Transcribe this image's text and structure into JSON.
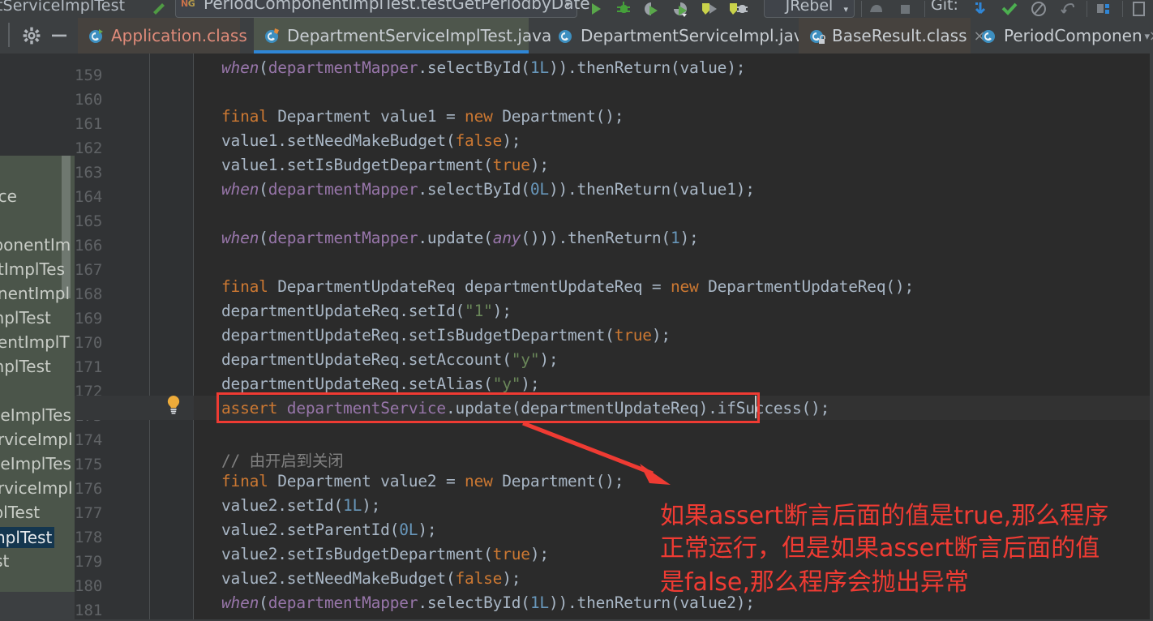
{
  "toolbar": {
    "breadcrumb_text": "tServiceImplTest",
    "run_config": {
      "icon": "testng-icon",
      "icon_text": "N",
      "icon_text2": "G",
      "label": "PeriodComponentImplTest.testGetPeriodbyDate",
      "arrow": "▾"
    },
    "icons": [
      {
        "name": "run-icon",
        "glyph": "▶",
        "color": "#5a9b4f"
      },
      {
        "name": "debug-icon",
        "glyph": "✱",
        "color": "#4a9c3f"
      },
      {
        "name": "run-with-coverage-icon",
        "glyph": "▶",
        "color": "#6aa050"
      },
      {
        "name": "profile-icon",
        "glyph": "▶",
        "color": "#6aa050"
      },
      {
        "name": "run-test-icon",
        "glyph": "▶",
        "color": "#9aa845"
      },
      {
        "name": "debug-test-icon",
        "glyph": "▶",
        "color": "#9aa845"
      }
    ],
    "jrebel_label": "JRebel",
    "right_icons": [
      {
        "name": "attach-process-icon",
        "glyph": "●"
      },
      {
        "name": "stop-icon",
        "glyph": "■"
      },
      {
        "name": "git-label",
        "glyph": "Git:"
      },
      {
        "name": "update-project-icon",
        "glyph": "↰"
      },
      {
        "name": "commit-icon",
        "glyph": "✔"
      },
      {
        "name": "history-icon",
        "glyph": "⧖"
      },
      {
        "name": "rollback-icon",
        "glyph": "↶"
      },
      {
        "name": "layout-icon",
        "glyph": "▦"
      },
      {
        "name": "search-everywhere-icon",
        "glyph": "⌕"
      }
    ]
  },
  "tabbar": {
    "gear_icon": "settings-gear-icon",
    "minimize_icon": "hide-icon",
    "tabs": [
      {
        "label": "Application.class",
        "icon": "java-class-icon",
        "active": false,
        "color": "#e08b7a",
        "close": "×"
      },
      {
        "label": "DepartmentServiceImplTest.java",
        "icon": "java-file-icon",
        "active": true,
        "color": "#c8cdd2",
        "close": "×"
      },
      {
        "label": "DepartmentServiceImpl.java",
        "icon": "java-file-icon",
        "active": false,
        "color": "#c8cdd2",
        "close": "×"
      },
      {
        "label": "BaseResult.class",
        "icon": "java-class-locked-icon",
        "active": false,
        "color": "#c8cdd2",
        "close": "×"
      },
      {
        "label": "PeriodComponen",
        "icon": "java-class-icon",
        "active": false,
        "color": "#c8cdd2",
        "close": "×"
      }
    ],
    "overflow": "▾"
  },
  "project_panel": {
    "rows": [
      "rvice",
      "mponentIm",
      "entImplTes",
      "ponentImpl",
      "tImplTest",
      "onentImplT",
      "tImplTest",
      "viceImplTes",
      "ServiceImpl",
      "viceImplTes",
      "ServiceImpl",
      "mplTest",
      "eImplTest",
      "Test"
    ],
    "selected_index": 12
  },
  "editor": {
    "first_line_number": 159,
    "line_height": 30,
    "caret_line": 173,
    "bulb_icon": "intention-bulb-icon",
    "lines": [
      {
        "n": 159,
        "tokens": [
          {
            "t": "when",
            "c": "stm"
          },
          {
            "t": "(",
            "c": "id"
          },
          {
            "t": "departmentMapper",
            "c": "fld"
          },
          {
            "t": ".selectById(",
            "c": "id"
          },
          {
            "t": "1L",
            "c": "num"
          },
          {
            "t": ")).thenReturn(value);",
            "c": "id"
          }
        ]
      },
      {
        "n": 160,
        "tokens": []
      },
      {
        "n": 161,
        "tokens": [
          {
            "t": "final",
            "c": "kw"
          },
          {
            "t": " Department value1 = ",
            "c": "id"
          },
          {
            "t": "new",
            "c": "kw"
          },
          {
            "t": " Department();",
            "c": "id"
          }
        ]
      },
      {
        "n": 162,
        "tokens": [
          {
            "t": "value1.setNeedMakeBudget(",
            "c": "id"
          },
          {
            "t": "false",
            "c": "kw"
          },
          {
            "t": ");",
            "c": "id"
          }
        ]
      },
      {
        "n": 163,
        "tokens": [
          {
            "t": "value1.setIsBudgetDepartment(",
            "c": "id"
          },
          {
            "t": "true",
            "c": "kw"
          },
          {
            "t": ");",
            "c": "id"
          }
        ]
      },
      {
        "n": 164,
        "tokens": [
          {
            "t": "when",
            "c": "stm"
          },
          {
            "t": "(",
            "c": "id"
          },
          {
            "t": "departmentMapper",
            "c": "fld"
          },
          {
            "t": ".selectById(",
            "c": "id"
          },
          {
            "t": "0L",
            "c": "num"
          },
          {
            "t": ")).thenReturn(value1);",
            "c": "id"
          }
        ]
      },
      {
        "n": 165,
        "tokens": []
      },
      {
        "n": 166,
        "tokens": [
          {
            "t": "when",
            "c": "stm"
          },
          {
            "t": "(",
            "c": "id"
          },
          {
            "t": "departmentMapper",
            "c": "fld"
          },
          {
            "t": ".update(",
            "c": "id"
          },
          {
            "t": "any",
            "c": "stm"
          },
          {
            "t": "())).thenReturn(",
            "c": "id"
          },
          {
            "t": "1",
            "c": "num"
          },
          {
            "t": ");",
            "c": "id"
          }
        ]
      },
      {
        "n": 167,
        "tokens": []
      },
      {
        "n": 168,
        "tokens": [
          {
            "t": "final",
            "c": "kw"
          },
          {
            "t": " DepartmentUpdateReq departmentUpdateReq = ",
            "c": "id"
          },
          {
            "t": "new",
            "c": "kw"
          },
          {
            "t": " DepartmentUpdateReq();",
            "c": "id"
          }
        ]
      },
      {
        "n": 169,
        "tokens": [
          {
            "t": "departmentUpdateReq.setId(",
            "c": "id"
          },
          {
            "t": "\"1\"",
            "c": "st"
          },
          {
            "t": ");",
            "c": "id"
          }
        ]
      },
      {
        "n": 170,
        "tokens": [
          {
            "t": "departmentUpdateReq.setIsBudgetDepartment(",
            "c": "id"
          },
          {
            "t": "true",
            "c": "kw"
          },
          {
            "t": ");",
            "c": "id"
          }
        ]
      },
      {
        "n": 171,
        "tokens": [
          {
            "t": "departmentUpdateReq.setAccount(",
            "c": "id"
          },
          {
            "t": "\"y\"",
            "c": "st"
          },
          {
            "t": ");",
            "c": "id"
          }
        ]
      },
      {
        "n": 172,
        "tokens": [
          {
            "t": "departmentUpdateReq.setAlias(",
            "c": "id"
          },
          {
            "t": "\"y\"",
            "c": "st"
          },
          {
            "t": ");",
            "c": "id"
          }
        ]
      },
      {
        "n": 173,
        "tokens": [
          {
            "t": "assert",
            "c": "kw"
          },
          {
            "t": " ",
            "c": "id"
          },
          {
            "t": "departmentService",
            "c": "fld"
          },
          {
            "t": ".update(departmentUpdateReq).ifSuccess();",
            "c": "id"
          }
        ]
      },
      {
        "n": 174,
        "tokens": []
      },
      {
        "n": 175,
        "tokens": [
          {
            "t": "// 由开启到关闭",
            "c": "cm"
          }
        ]
      },
      {
        "n": 176,
        "tokens": [
          {
            "t": "final",
            "c": "kw"
          },
          {
            "t": " Department value2 = ",
            "c": "id"
          },
          {
            "t": "new",
            "c": "kw"
          },
          {
            "t": " Department();",
            "c": "id"
          }
        ]
      },
      {
        "n": 177,
        "tokens": [
          {
            "t": "value2.setId(",
            "c": "id"
          },
          {
            "t": "1L",
            "c": "num"
          },
          {
            "t": ");",
            "c": "id"
          }
        ]
      },
      {
        "n": 178,
        "tokens": [
          {
            "t": "value2.setParentId(",
            "c": "id"
          },
          {
            "t": "0L",
            "c": "num"
          },
          {
            "t": ");",
            "c": "id"
          }
        ]
      },
      {
        "n": 179,
        "tokens": [
          {
            "t": "value2.setIsBudgetDepartment(",
            "c": "id"
          },
          {
            "t": "true",
            "c": "kw"
          },
          {
            "t": ");",
            "c": "id"
          }
        ]
      },
      {
        "n": 180,
        "tokens": [
          {
            "t": "value2.setNeedMakeBudget(",
            "c": "id"
          },
          {
            "t": "false",
            "c": "kw"
          },
          {
            "t": ");",
            "c": "id"
          }
        ]
      },
      {
        "n": 181,
        "tokens": [
          {
            "t": "when",
            "c": "stm"
          },
          {
            "t": "(",
            "c": "id"
          },
          {
            "t": "departmentMapper",
            "c": "fld"
          },
          {
            "t": ".selectById(",
            "c": "id"
          },
          {
            "t": "1L",
            "c": "num"
          },
          {
            "t": ")).thenReturn(value2);",
            "c": "id"
          }
        ]
      }
    ]
  },
  "annotation": {
    "color": "#ef3b33",
    "highlight_box": {
      "line": 173
    },
    "text_lines": [
      "如果assert断言后面的值是true,那么程序",
      "正常运行，但是如果assert断言后面的值",
      "是false,那么程序会抛出异常"
    ]
  }
}
